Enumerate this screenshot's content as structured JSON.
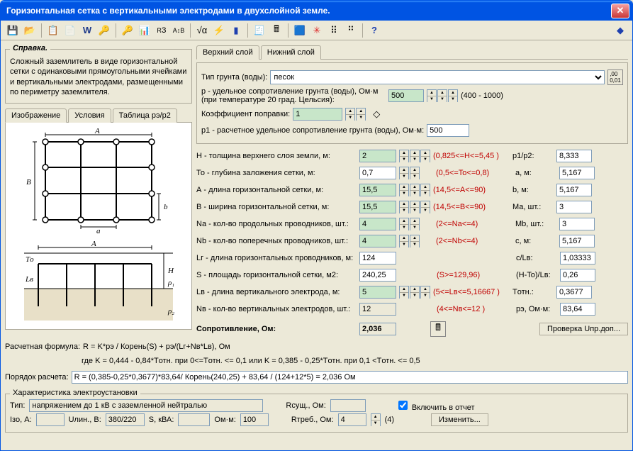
{
  "window": {
    "title": "Горизонтальная сетка с вертикальными электродами в двухслойной земле."
  },
  "help": {
    "legend": "Справка.",
    "text": "Сложный заземлитель в виде горизонтальной сетки с одинаковыми прямоугольными ячейками и вертикальными электродами, размещенными по периметру заземлителя."
  },
  "imgTabs": [
    "Изображение",
    "Условия",
    "Таблица рэ/р2"
  ],
  "soilTabs": [
    "Верхний слой",
    "Нижний слой"
  ],
  "soil": {
    "typeLabel": "Тип грунта (воды):",
    "typeValue": "песок",
    "pLabel": "p - удельное сопротивление грунта (воды), Ом·м (при температуре 20 град. Цельсия):",
    "pValue": "500",
    "pRange": "(400 - 1000)",
    "kLabel": "Коэффициент поправки:",
    "kValue": "1",
    "p1Label": "p1 - расчетное удельное сопротивление грунта (воды), Ом·м:",
    "p1Value": "500"
  },
  "params": [
    {
      "l": "H - толщина верхнего слоя земли, м:",
      "v": "2",
      "g": true,
      "sp": 3,
      "h": "(0,825<=H<=5,45 )",
      "rl": "p1/p2:",
      "rv": "8,333"
    },
    {
      "l": "То - глубина заложения сетки, м:",
      "v": "0,7",
      "g": false,
      "sp": 2,
      "h": "(0,5<=To<=0,8)",
      "rl": "a, м:",
      "rv": "5,167"
    },
    {
      "l": "А - длина горизонтальной сетки, м:",
      "v": "15,5",
      "g": true,
      "sp": 3,
      "h": "(14,5<=A<=90)",
      "rl": "b, м:",
      "rv": "5,167"
    },
    {
      "l": "B - ширина горизонтальной сетки, м:",
      "v": "15,5",
      "g": true,
      "sp": 3,
      "h": "(14,5<=B<=90)",
      "rl": "Ма, шт.:",
      "rv": "3"
    },
    {
      "l": "Na - кол-во продольных проводников, шт.:",
      "v": "4",
      "g": true,
      "sp": 2,
      "h": "(2<=Na<=4)",
      "rl": "Mb, шт.:",
      "rv": "3"
    },
    {
      "l": "Nb - кол-во поперечных проводников, шт.:",
      "v": "4",
      "g": true,
      "sp": 2,
      "h": "(2<=Nb<=4)",
      "rl": "c, м:",
      "rv": "5,167"
    },
    {
      "l": "Lг - длина горизонтальных проводников, м:",
      "v": "124",
      "g": false,
      "sp": 0,
      "h": "",
      "rl": "c/Lв:",
      "rv": "1,03333"
    },
    {
      "l": "S - площадь горизонтальной сетки, м2:",
      "v": "240,25",
      "g": false,
      "sp": 0,
      "h": "(S>=129,96)",
      "rl": "(H-To)/Lв:",
      "rv": "0,26"
    },
    {
      "l": "Lв - длина вертикального электрода, м:",
      "v": "5",
      "g": true,
      "sp": 3,
      "h": "(5<=Lв<=5,16667 )",
      "rl": "Tотн.:",
      "rv": "0,3677"
    },
    {
      "l": "Nв - кол-во вертикальных электродов, шт.:",
      "v": "12",
      "g": false,
      "sp": 0,
      "ro": true,
      "h": "(4<=Nв<=12 )",
      "rl": "рэ, Ом·м:",
      "rv": "83,64"
    }
  ],
  "resistance": {
    "label": "Сопротивление, Ом:",
    "value": "2,036",
    "btn": "Проверка Uпр.доп..."
  },
  "formula": {
    "label": "Расчетная формула:",
    "line1": "R = K*рэ / Корень(S) + рэ/(Lг+Nв*Lв), Ом",
    "line2": "где K = 0,444 - 0,84*Tотн.  при  0<=Tотн. <= 0,1  или  K = 0,385 - 0,25*Tотн.  при  0,1 <Tотн. <= 0,5"
  },
  "order": {
    "label": "Порядок расчета:",
    "value": "R = (0,385-0,25*0,3677)*83,64/ Корень(240,25) + 83,64 / (124+12*5) = 2,036 Ом"
  },
  "char": {
    "legend": "Характеристика электроустановки",
    "typeLabel": "Тип:",
    "typeValue": "напряжением до 1 кВ с заземленной нейтралью",
    "izoLabel": "Iзо, А:",
    "izoValue": "",
    "ulinLabel": "Uлин., В:",
    "ulinValue": "380/220",
    "sLabel": "S, кВА:",
    "sValue": "",
    "omLabel": "Ом·м:",
    "omValue": "100",
    "rsLabel": "Rсущ., Ом:",
    "rsValue": "",
    "rtLabel": "Rтреб., Ом:",
    "rtValue": "4",
    "rtHint": "(4)",
    "include": "Включить в отчет",
    "btn": "Изменить..."
  }
}
